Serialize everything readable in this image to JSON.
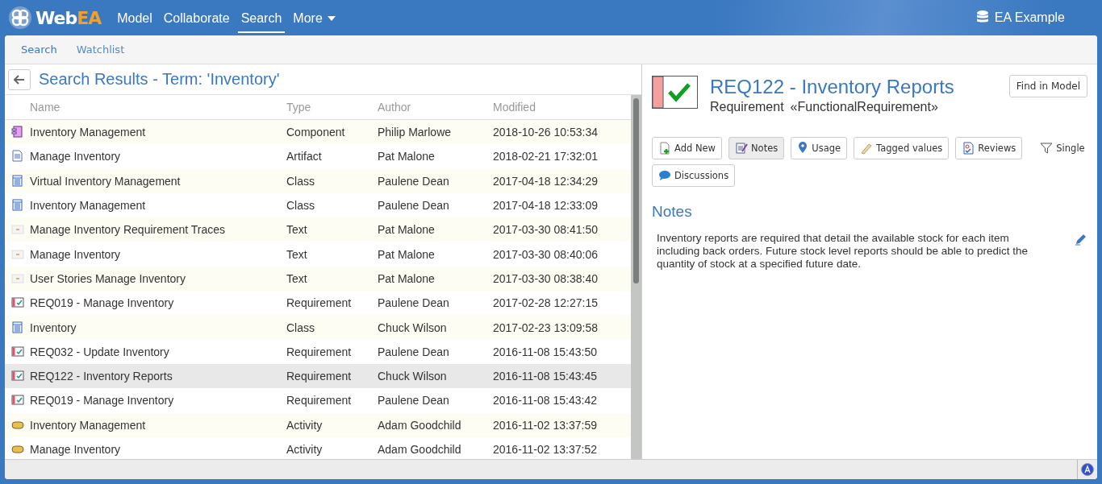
{
  "app": {
    "logo_prefix": "Web",
    "logo_suffix": "EA",
    "nav": [
      {
        "label": "Model",
        "selected": false
      },
      {
        "label": "Collaborate",
        "selected": false
      },
      {
        "label": "Search",
        "selected": true
      },
      {
        "label": "More",
        "selected": false,
        "dropdown": true
      }
    ],
    "model_name": "EA Example"
  },
  "tabs": [
    {
      "label": "Search",
      "selected": true
    },
    {
      "label": "Watchlist",
      "selected": false
    }
  ],
  "results": {
    "title": "Search Results - Term: 'Inventory'",
    "columns": [
      "Name",
      "Type",
      "Author",
      "Modified"
    ],
    "rows": [
      {
        "kind": "component",
        "name": "Inventory Management",
        "type": "Component",
        "author": "Philip Marlowe",
        "modified": "2018-10-26 10:53:34",
        "selected": false
      },
      {
        "kind": "artifact",
        "name": "Manage Inventory",
        "type": "Artifact",
        "author": "Pat Malone",
        "modified": "2018-02-21 17:32:01",
        "selected": false
      },
      {
        "kind": "class",
        "name": "Virtual Inventory Management",
        "type": "Class",
        "author": "Paulene Dean",
        "modified": "2017-04-18 12:34:29",
        "selected": false
      },
      {
        "kind": "class",
        "name": "Inventory Management",
        "type": "Class",
        "author": "Paulene Dean",
        "modified": "2017-04-18 12:33:09",
        "selected": false
      },
      {
        "kind": "text",
        "name": "Manage Inventory Requirement Traces",
        "type": "Text",
        "author": "Pat Malone",
        "modified": "2017-03-30 08:41:50",
        "selected": false
      },
      {
        "kind": "text",
        "name": "Manage Inventory",
        "type": "Text",
        "author": "Pat Malone",
        "modified": "2017-03-30 08:40:06",
        "selected": false
      },
      {
        "kind": "text",
        "name": "User Stories Manage Inventory",
        "type": "Text",
        "author": "Pat Malone",
        "modified": "2017-03-30 08:38:40",
        "selected": false
      },
      {
        "kind": "requirement",
        "name": "REQ019 - Manage Inventory",
        "type": "Requirement",
        "author": "Paulene Dean",
        "modified": "2017-02-28 12:27:15",
        "selected": false
      },
      {
        "kind": "class",
        "name": "Inventory",
        "type": "Class",
        "author": "Chuck Wilson",
        "modified": "2017-02-23 13:09:58",
        "selected": false
      },
      {
        "kind": "requirement",
        "name": "REQ032 - Update Inventory",
        "type": "Requirement",
        "author": "Paulene Dean",
        "modified": "2016-11-08 15:43:50",
        "selected": false
      },
      {
        "kind": "requirement",
        "name": "REQ122 - Inventory Reports",
        "type": "Requirement",
        "author": "Chuck Wilson",
        "modified": "2016-11-08 15:43:45",
        "selected": true
      },
      {
        "kind": "requirement",
        "name": "REQ019 - Manage Inventory",
        "type": "Requirement",
        "author": "Paulene Dean",
        "modified": "2016-11-08 15:43:42",
        "selected": false
      },
      {
        "kind": "activity",
        "name": "Inventory Management",
        "type": "Activity",
        "author": "Adam Goodchild",
        "modified": "2016-11-02 13:37:59",
        "selected": false
      },
      {
        "kind": "activity",
        "name": "Manage Inventory",
        "type": "Activity",
        "author": "Adam Goodchild",
        "modified": "2016-11-02 13:37:52",
        "selected": false
      }
    ]
  },
  "detail": {
    "title": "REQ122 - Inventory Reports",
    "type": "Requirement",
    "stereotype": "«FunctionalRequirement»",
    "find_button": "Find in Model",
    "actions": [
      {
        "kind": "add",
        "label": "Add New",
        "selected": false
      },
      {
        "kind": "notes",
        "label": "Notes",
        "selected": true
      },
      {
        "kind": "usage",
        "label": "Usage",
        "selected": false
      },
      {
        "kind": "tagged",
        "label": "Tagged values",
        "selected": false
      },
      {
        "kind": "reviews",
        "label": "Reviews",
        "selected": false
      },
      {
        "kind": "filter",
        "label": "Single",
        "selected": false
      },
      {
        "kind": "discussions",
        "label": "Discussions",
        "selected": false
      }
    ],
    "section_title": "Notes",
    "notes": "Inventory reports are required that detail the available stock for each item including back orders. Future stock level reports should be able to predict the quantity of stock at a specified future date."
  }
}
